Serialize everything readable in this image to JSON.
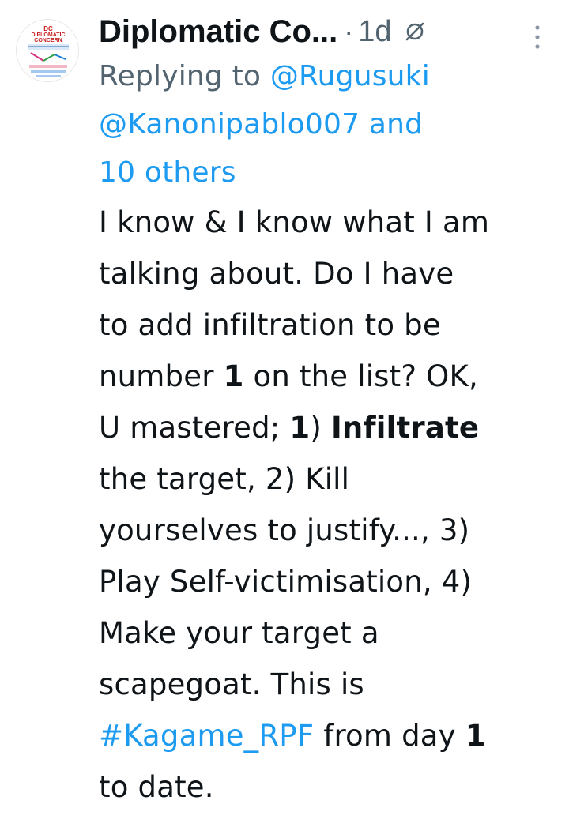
{
  "author": {
    "display_name": "Diplomatic Co...",
    "separator": "·",
    "timestamp": "1d",
    "avatar_icon": "diplomatic-concern-logo",
    "avatar_text": [
      "DC",
      "DIPLOMATIC",
      "CONCERN"
    ]
  },
  "reply": {
    "prefix": "Replying to",
    "mention_1": "@Rugusuki",
    "mention_2": "@Kanonipablo007",
    "joiner": "and",
    "others": "10 others"
  },
  "body": {
    "l1": "I know & I know what I am",
    "l2": "talking about. Do I have",
    "l3": "to add infiltration to be",
    "l4_a": "number ",
    "l4_b": "1",
    "l4_c": " on the list? OK,",
    "l5_a": "U mastered; ",
    "l5_b": "1",
    "l5_c": ") ",
    "l5_d": "Infiltrate",
    "l6": "the target, 2) Kill",
    "l7": "yourselves to justify..., 3)",
    "l8": "Play Self-victimisation, 4)",
    "l9": "Make your target a",
    "l10": "scapegoat. This is",
    "l11_hashtag": "#Kagame_RPF",
    "l11_b": " from day ",
    "l11_c": "1",
    "l12": "to date."
  },
  "colors": {
    "link": "#1d9bf0",
    "muted": "#536471",
    "text": "#0f1419"
  },
  "icons": {
    "grok": "grok-icon",
    "more": "more-vertical-icon"
  }
}
